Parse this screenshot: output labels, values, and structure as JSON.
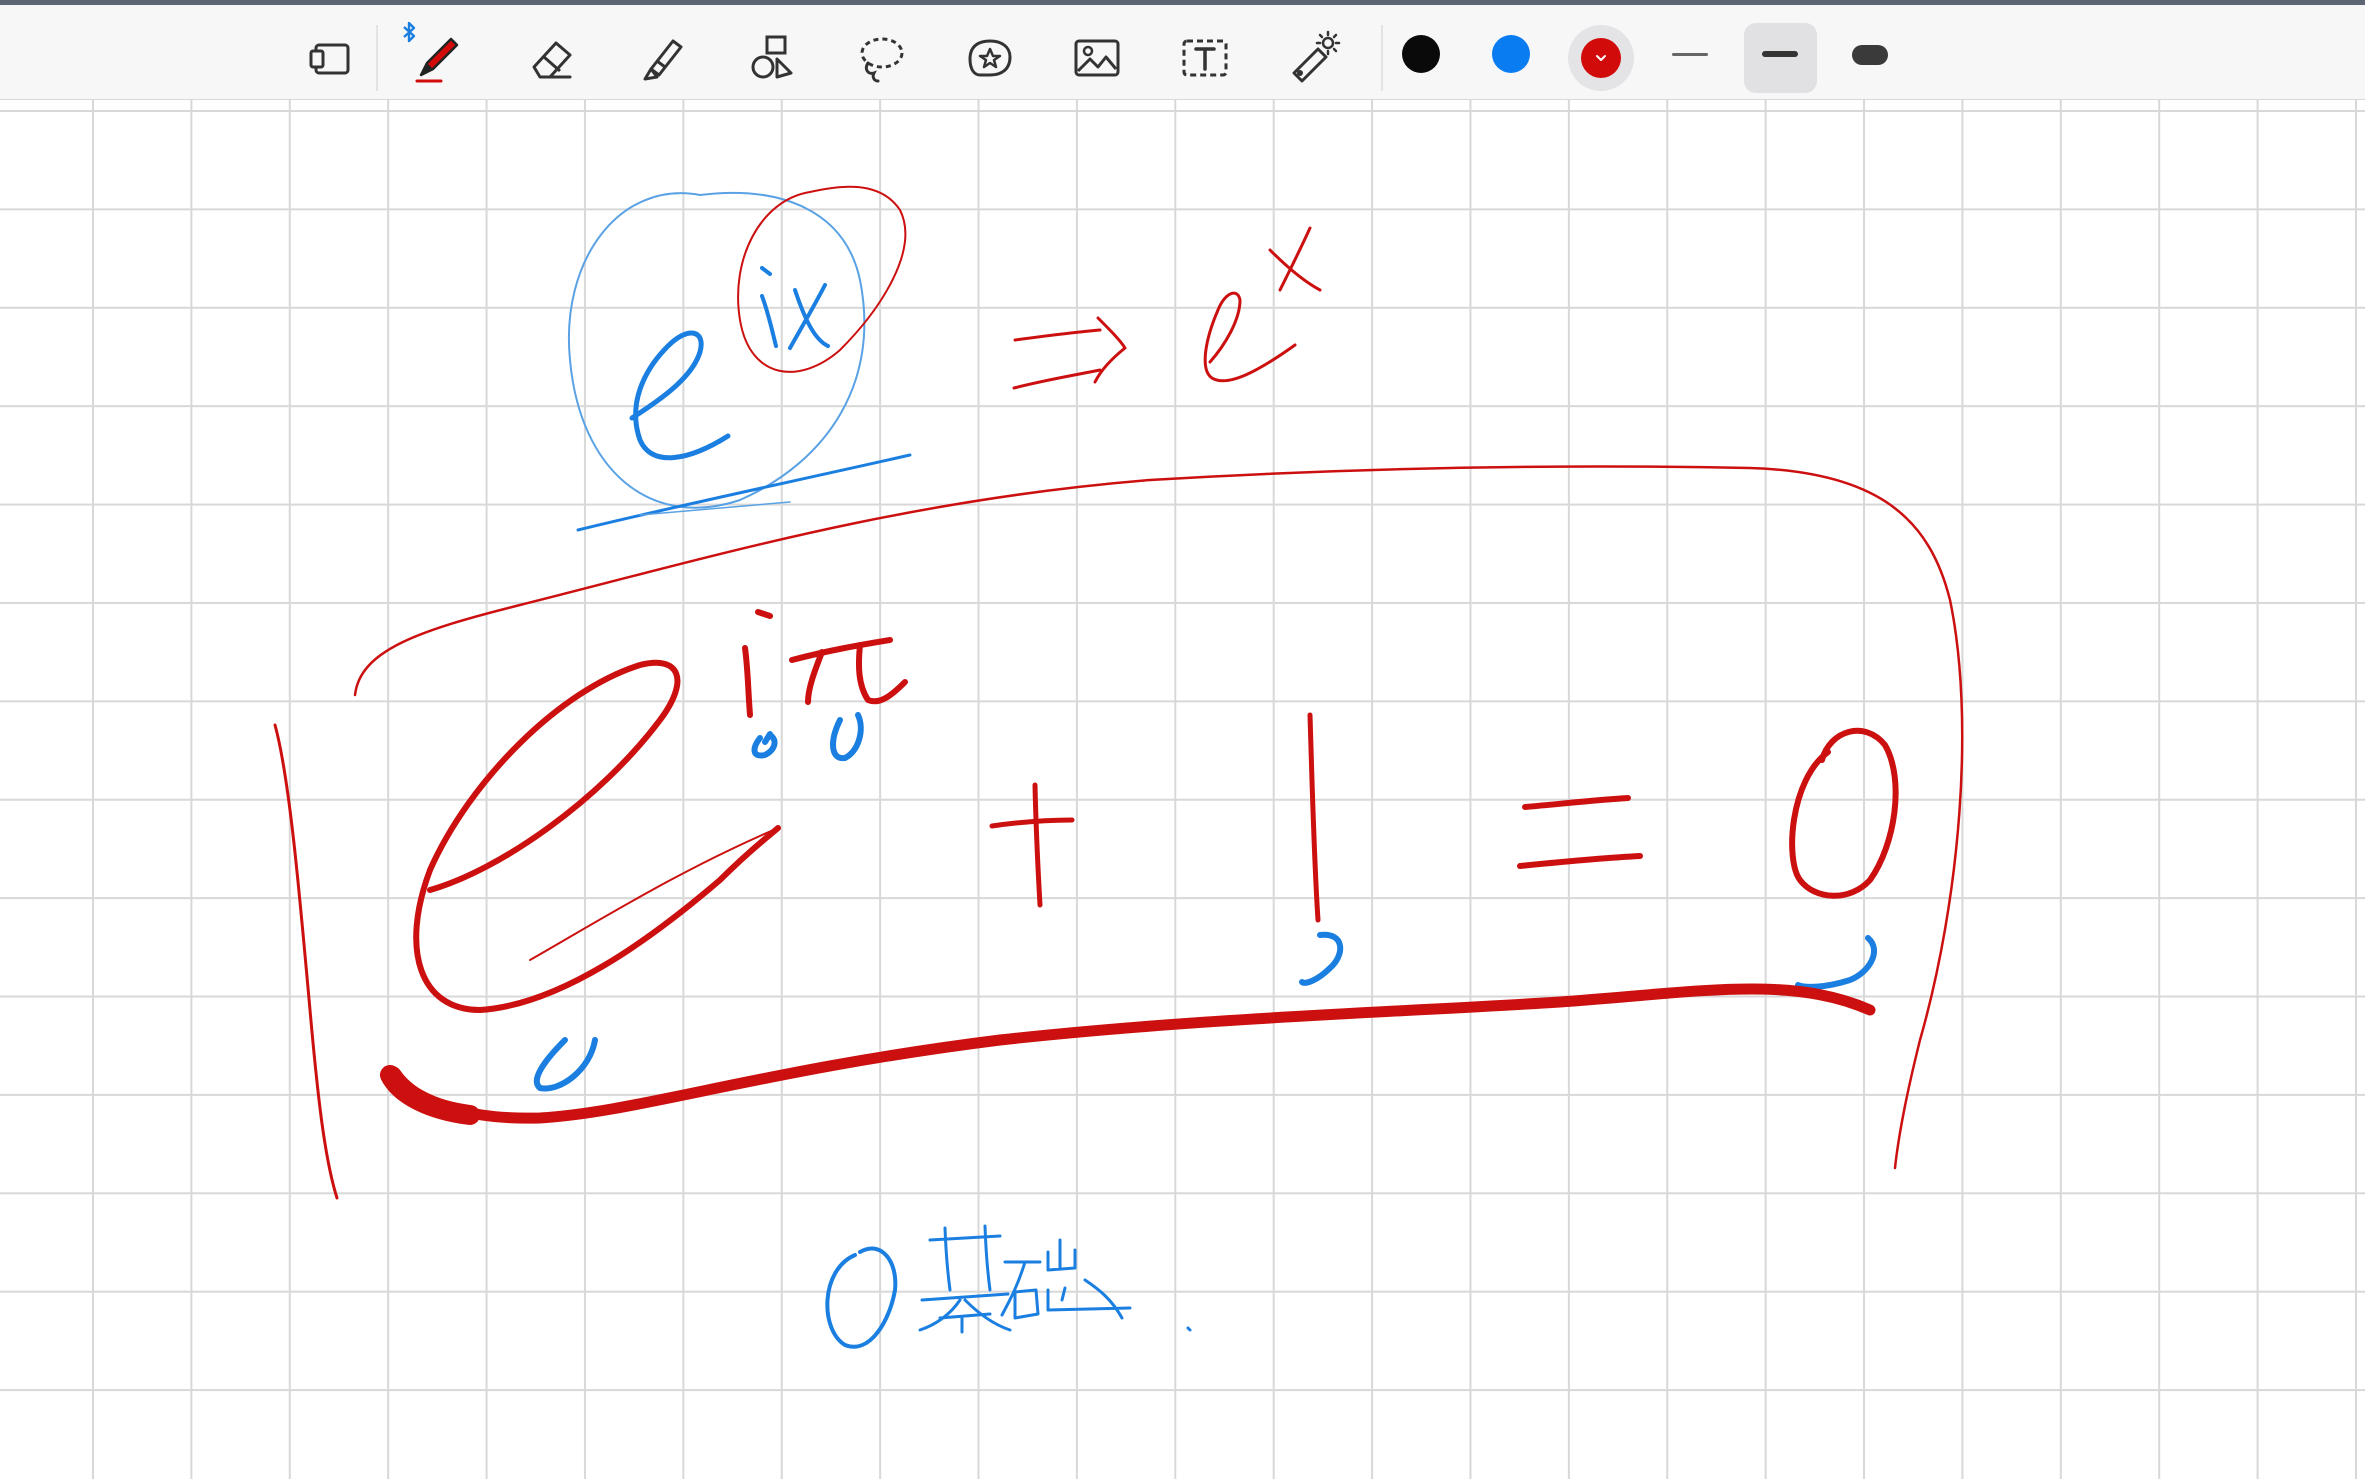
{
  "toolbar": {
    "tools": [
      {
        "name": "page-layout-tool",
        "icon": "page-layout-icon"
      },
      {
        "name": "pen-tool",
        "icon": "pen-icon",
        "selected": true
      },
      {
        "name": "eraser-tool",
        "icon": "eraser-icon"
      },
      {
        "name": "highlighter-tool",
        "icon": "highlighter-icon"
      },
      {
        "name": "shapes-tool",
        "icon": "shapes-icon"
      },
      {
        "name": "lasso-tool",
        "icon": "lasso-icon"
      },
      {
        "name": "sticker-tool",
        "icon": "sticker-icon"
      },
      {
        "name": "image-tool",
        "icon": "image-icon"
      },
      {
        "name": "text-tool",
        "icon": "text-box-icon"
      },
      {
        "name": "laser-pointer-tool",
        "icon": "laser-pointer-icon"
      }
    ],
    "bluetooth_icon": "bluetooth-icon",
    "colors": [
      {
        "name": "black",
        "hex": "#0a0a0a"
      },
      {
        "name": "blue",
        "hex": "#0a7cf2"
      },
      {
        "name": "red",
        "hex": "#d10a0a",
        "selected": true
      }
    ],
    "stroke_widths": [
      "thin",
      "medium",
      "thick"
    ],
    "selected_stroke_width": "medium"
  },
  "canvas": {
    "paper": "grid",
    "grid_color": "#d8d8d8",
    "ink_colors": {
      "red": "#cc1010",
      "blue": "#1a7fe0",
      "light_blue": "#5aa2e4"
    },
    "handwritten_content": "e^{iπ} + 1 = 0"
  }
}
